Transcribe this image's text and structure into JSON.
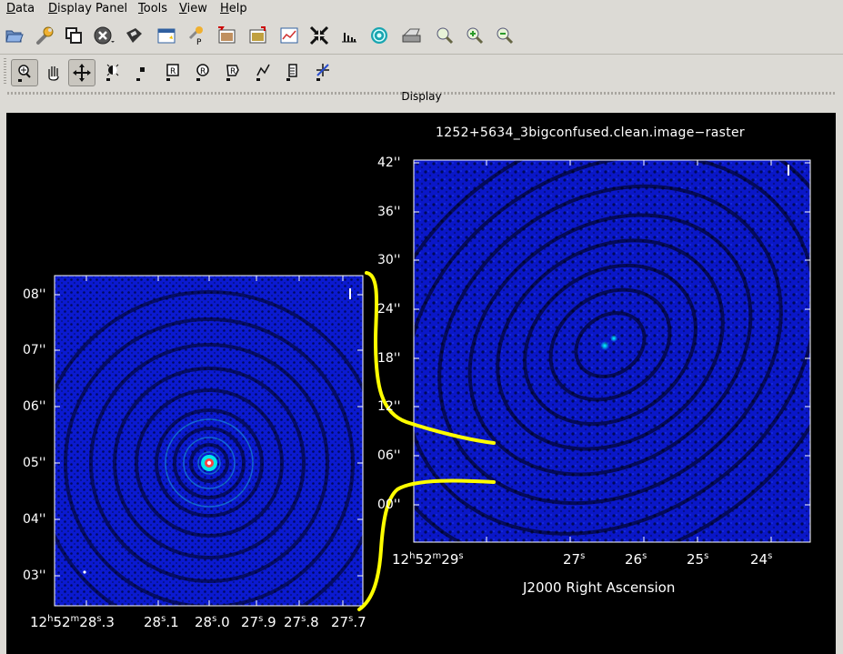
{
  "menu": [
    "Data",
    "Display Panel",
    "Tools",
    "View",
    "Help"
  ],
  "menu_underline": [
    "D",
    "D",
    "T",
    "V",
    "H"
  ],
  "toolbar1": [
    "open-folder-icon",
    "wrench-icon",
    "copy-panel-icon",
    "close-circle-icon",
    "save-disk-icon",
    "new-panel-icon",
    "print-setup-icon",
    "image-export-icon",
    "image-save-icon",
    "line-chart-icon",
    "shrink-arrows-icon",
    "histogram-icon",
    "target-ring-icon",
    "printer-icon",
    "zoom-fit-icon",
    "zoom-in-icon",
    "zoom-out-icon"
  ],
  "toolbar2": [
    "zoom-tool-icon",
    "pan-hand-icon",
    "move-arrows-icon",
    "contrast-tool-icon",
    "point-tool-icon",
    "rect-region-icon",
    "ellipse-region-icon",
    "polygon-region-icon",
    "polyline-region-icon",
    "scale-bar-icon",
    "crosshair-slash-icon"
  ],
  "dock_title": "Display",
  "panel_right": {
    "title": "1252+5634_3bigconfused.clean.image−raster",
    "y_ticks": [
      "42''",
      "36''",
      "30''",
      "24''",
      "18''",
      "12''",
      "06''",
      "00''"
    ],
    "x_ticks_secs": [
      "27",
      "26",
      "25",
      "24"
    ],
    "x_first_tick": {
      "hours": "12",
      "minutes": "52",
      "seconds": "29"
    },
    "x_axis_label": "J2000 Right Ascension"
  },
  "panel_left": {
    "y_ticks": [
      "08''",
      "07''",
      "06''",
      "05''",
      "04''",
      "03''"
    ],
    "x_first_tick": {
      "hours": "12",
      "minutes": "52",
      "seconds": "28",
      "frac": ".3"
    },
    "x_ticks": [
      {
        "s": "28",
        "f": ".1"
      },
      {
        "s": "28",
        "f": ".0"
      },
      {
        "s": "27",
        "f": ".9"
      },
      {
        "s": "27",
        "f": ".8"
      },
      {
        "s": "27",
        "f": ".7"
      }
    ]
  },
  "colors": {
    "background": "#000000",
    "image_blue": "#0a17c8",
    "annotation": "#ffff00",
    "chrome": "#dcdad5"
  }
}
